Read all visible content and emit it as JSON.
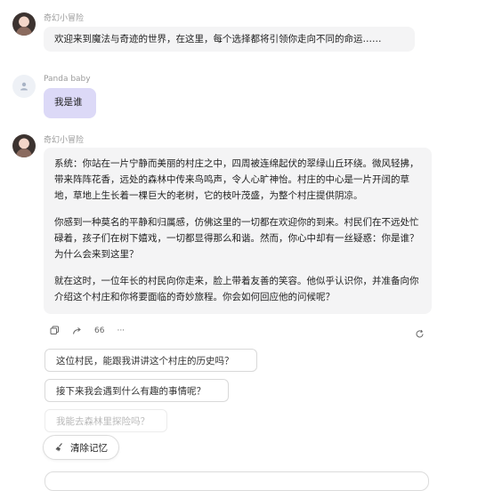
{
  "messages": [
    {
      "name": "奇幻小冒险",
      "text": "欢迎来到魔法与奇迹的世界，在这里，每个选择都将引领你走向不同的命运……"
    },
    {
      "name": "Panda baby",
      "text": "我是谁"
    },
    {
      "name": "奇幻小冒险",
      "paragraphs": [
        "系统：你站在一片宁静而美丽的村庄之中，四周被连绵起伏的翠绿山丘环绕。微风轻拂，带来阵阵花香，远处的森林中传来鸟鸣声，令人心旷神怡。村庄的中心是一片开阔的草地，草地上生长着一棵巨大的老树，它的枝叶茂盛，为整个村庄提供阴凉。",
        "你感到一种莫名的平静和归属感，仿佛这里的一切都在欢迎你的到来。村民们在不远处忙碌着，孩子们在树下嬉戏，一切都显得那么和谐。然而，你心中却有一丝疑惑：你是谁？为什么会来到这里？",
        "就在这时，一位年长的村民向你走来，脸上带着友善的笑容。他似乎认识你，并准备向你介绍这个村庄和你将要面临的奇妙旅程。你会如何回应他的问候呢？"
      ]
    }
  ],
  "toolbar": {
    "quote_label": "66",
    "more_label": "···"
  },
  "suggestions": [
    "这位村民，能跟我讲讲这个村庄的历史吗？",
    "接下来我会遇到什么有趣的事情呢？",
    "我能去森林里探险吗？"
  ],
  "clear_button": {
    "label": "清除记忆"
  },
  "icons": {
    "copy": "copy-icon",
    "share": "share-icon",
    "refresh": "refresh-icon",
    "clear": "broom-icon",
    "user": "user-icon"
  }
}
